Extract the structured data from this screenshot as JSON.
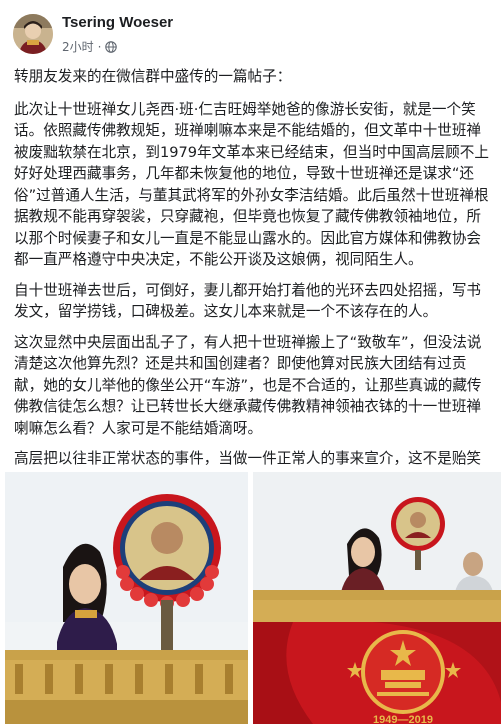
{
  "author": {
    "name": "Tsering Woeser"
  },
  "timestamp": "2小时",
  "post": {
    "intro": "转朋友发来的在微信群中盛传的一篇帖子：",
    "paragraphs": [
      "此次让十世班禅女儿尧西·班·仁吉旺姆举她爸的像游长安街，就是一个笑话。依照藏传佛教规矩，班禅喇嘛本来是不能结婚的，但文革中十世班禅被废黜软禁在北京，到1979年文革本来已经结束，但当时中国高层顾不上好好处理西藏事务，几年都未恢复他的地位，导致十世班禅还是谋求“还俗”过普通人生活，与董其武将军的外孙女李洁结婚。此后虽然十世班禅根据教规不能再穿袈裟，只穿藏袍，但毕竟也恢复了藏传佛教领袖地位，所以那个时候妻子和女儿一直是不能显山露水的。因此官方媒体和佛教协会都一直严格遵守中央决定，不能公开谈及这娘俩，视同陌生人。",
      "自十世班禅去世后，可倒好，妻儿都开始打着他的光环去四处招摇，写书发文，留学捞钱，口碑极差。这女儿本来就是一个不该存在的人。",
      "这次显然中央层面出乱子了，有人把十世班禅搬上了“致敬车”，但没法说清楚这次他算先烈？还是共和国创建者？即使他算对民族大团结有过贡献，她的女儿举他的像坐公开“车游”，也是不合适的，让那些真诚的藏传佛教信徒怎么想？让已转世长大继承藏传佛教精神领袖衣钵的十一世班禅喇嘛怎么看？人家可是不能结婚滴呀。",
      "高层把以往非正常状态的事件，当做一件正常人的事来宣介，这不是贻笑大方么？"
    ]
  },
  "photo_right": {
    "banner_years": "1949—2019"
  },
  "colors": {
    "text": "#1c1e21",
    "meta": "#606770",
    "flag_red": "#c8161d",
    "gold": "#e8b84a"
  },
  "icons": {
    "privacy": "globe-icon"
  }
}
